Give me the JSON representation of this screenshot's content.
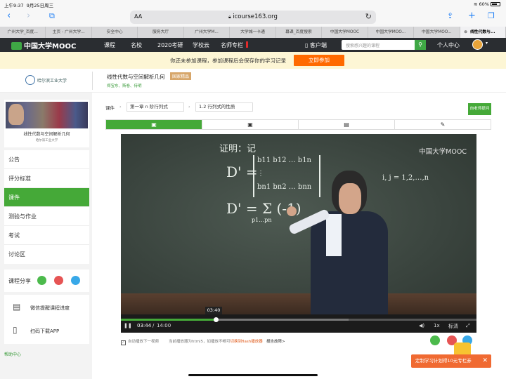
{
  "status": {
    "time": "上午9:37",
    "date": "9月25日周三",
    "battery": "60%"
  },
  "browser": {
    "aa": "AA",
    "url": "icourse163.org"
  },
  "tabs": [
    {
      "label": "广州大学_百度..."
    },
    {
      "label": "主页 - 广州大学..."
    },
    {
      "label": "安全中心"
    },
    {
      "label": "服务大厅"
    },
    {
      "label": "广州大学M..."
    },
    {
      "label": "大学城一卡通"
    },
    {
      "label": "幕课_百度搜索"
    },
    {
      "label": "中国大学MOOC"
    },
    {
      "label": "中国大学MOO..."
    },
    {
      "label": "中国大学MOO..."
    },
    {
      "label": "线性代数与..."
    }
  ],
  "site": {
    "logo": "中国大学MOOC",
    "nav": [
      "课程",
      "名校",
      "2020考研",
      "学校云",
      "名师专栏"
    ],
    "client": "客户端",
    "search_placeholder": "搜索感兴趣的课程",
    "personal": "个人中心"
  },
  "notice": {
    "text": "你还未参加课程，参加课程后会保存你的学习记录",
    "join": "立即参加"
  },
  "course": {
    "school": "哈尔滨工业大学",
    "title": "线性代数与空间解析几何",
    "badge": "国家精品",
    "teachers": "郑宝东、斯卷、侍明",
    "thumb_title": "线性代数与空间解析几何",
    "thumb_sub": "哈尔滨工业大学"
  },
  "sidebar": {
    "menu": [
      "公告",
      "评分标准",
      "课件",
      "测验与作业",
      "考试",
      "讨论区"
    ],
    "share": "课程分享",
    "wechat_reminder": "微信提醒课程进度",
    "scan_app": "扫码下载APP",
    "help": "帮助中心"
  },
  "main": {
    "breadcrumb_root": "课件",
    "chapter": "第一章 n 阶行列式",
    "section": "1.2 行列式的性质",
    "ask_button": "向老师提问",
    "tabs": [
      {
        "icon": "video-icon"
      },
      {
        "icon": "video-icon"
      },
      {
        "icon": "doc-icon"
      },
      {
        "icon": "note-icon"
      }
    ]
  },
  "video": {
    "watermark": "中国大学MOOC",
    "chalk_line1": "证明：记",
    "chalk_det_row1": "b11 b12 … b1n",
    "chalk_det_row3": "bn1 bn2 … bnn",
    "chalk_indices": "i, j = 1,2,…,n",
    "chalk_dprime": "D' =",
    "chalk_sum": "D' = Σ (-1)",
    "chalk_sum_sub": "p1…pn",
    "tooltip_time": "03:40",
    "current_time": "03:44",
    "duration": "14:00",
    "progress": 0.267,
    "buffered": 0.64,
    "speed": "1x",
    "quality": "标清"
  },
  "under_video": {
    "autoplay": "自动播放下一视频",
    "player_note": "当前播放器为html5，如播放不畅可",
    "switch_link": "切换到flash播放器",
    "report": "报告故障>"
  },
  "floating": {
    "text": "定制学习计划得10元专栏券",
    "close": "✕"
  }
}
